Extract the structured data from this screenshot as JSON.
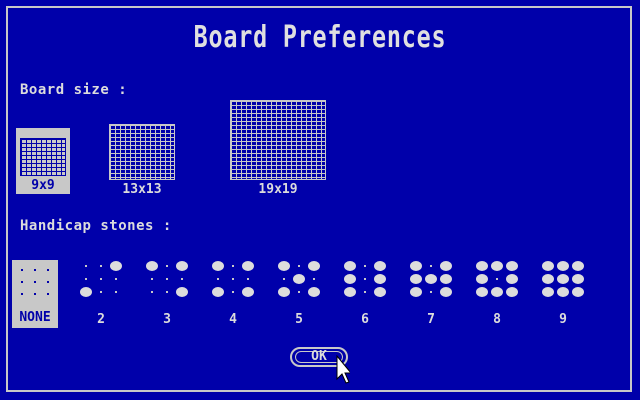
{
  "title": "Board Preferences",
  "board_size": {
    "label": "Board size :",
    "options": [
      {
        "label": "9x9",
        "selected": true
      },
      {
        "label": "13x13",
        "selected": false
      },
      {
        "label": "19x19",
        "selected": false
      }
    ]
  },
  "handicap": {
    "label": "Handicap stones :",
    "options": [
      {
        "label": "NONE",
        "selected": true
      },
      {
        "label": "2"
      },
      {
        "label": "3"
      },
      {
        "label": "4"
      },
      {
        "label": "5"
      },
      {
        "label": "6"
      },
      {
        "label": "7"
      },
      {
        "label": "8"
      },
      {
        "label": "9"
      }
    ]
  },
  "ok_label": "OK",
  "colors": {
    "background": "#0000aa",
    "foreground": "#c8c8c8"
  }
}
